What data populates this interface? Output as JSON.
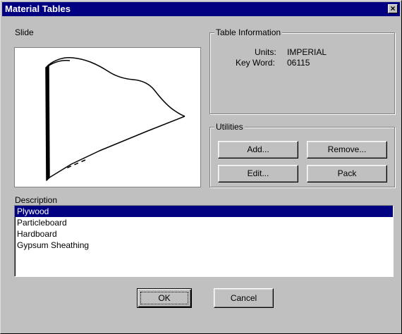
{
  "window": {
    "title": "Material Tables",
    "close_glyph": "×"
  },
  "slide": {
    "label": "Slide"
  },
  "table_info": {
    "legend": "Table Information",
    "units_label": "Units:",
    "units_value": "IMPERIAL",
    "keyword_label": "Key Word:",
    "keyword_value": "06115"
  },
  "utilities": {
    "legend": "Utilities",
    "add_label": "Add...",
    "remove_label": "Remove...",
    "edit_label": "Edit...",
    "pack_label": "Pack"
  },
  "description": {
    "label": "Description",
    "selected_index": 0,
    "items": [
      "Plywood",
      "Particleboard",
      "Hardboard",
      "Gypsum Sheathing"
    ]
  },
  "footer": {
    "ok_label": "OK",
    "cancel_label": "Cancel"
  },
  "colors": {
    "titlebar": "#000080",
    "face": "#c0c0c0",
    "selection": "#000080"
  }
}
